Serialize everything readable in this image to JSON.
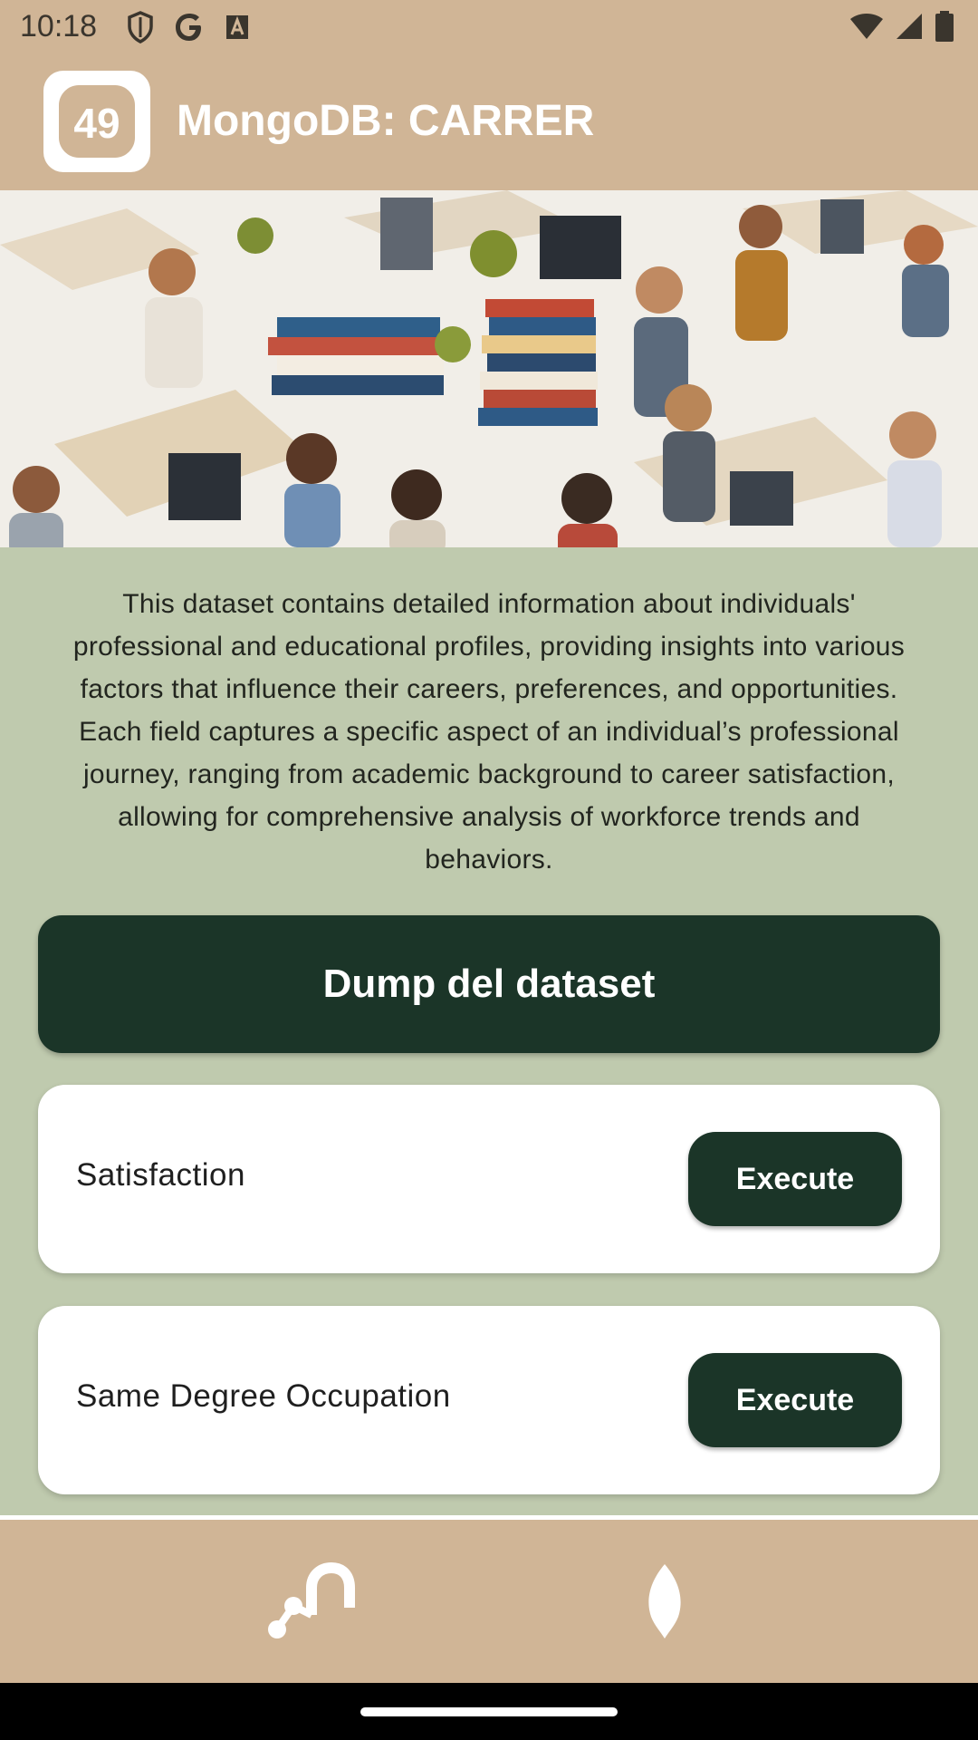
{
  "status_bar": {
    "time": "10:18",
    "icons_left": [
      "shield-icon",
      "google-icon",
      "font-icon"
    ],
    "icons_right": [
      "wifi-icon",
      "cellular-signal-icon",
      "battery-icon"
    ]
  },
  "app_bar": {
    "logo_text": "49",
    "title": "MongoDB: CARRER"
  },
  "hero": {
    "image_name": "workspace-illustration"
  },
  "description": "This dataset contains detailed information about individuals' professional and educational profiles, providing insights into various factors that influence their careers, preferences, and opportunities. Each field captures a specific aspect of an individual’s professional journey, ranging from academic background to career satisfaction, allowing for comprehensive analysis of workforce trends and behaviors.",
  "dump_button": "Dump del dataset",
  "queries": [
    {
      "label": "Satisfaction",
      "button": "Execute"
    },
    {
      "label": "Same Degree Occupation",
      "button": "Execute"
    }
  ],
  "bottom_nav": {
    "items": [
      "graph-nodes-icon",
      "mongodb-leaf-icon"
    ]
  },
  "colors": {
    "bar_background": "#d0b596",
    "page_background": "#bfcaae",
    "button_dark_green": "#1b3528",
    "card_background": "#ffffff"
  }
}
